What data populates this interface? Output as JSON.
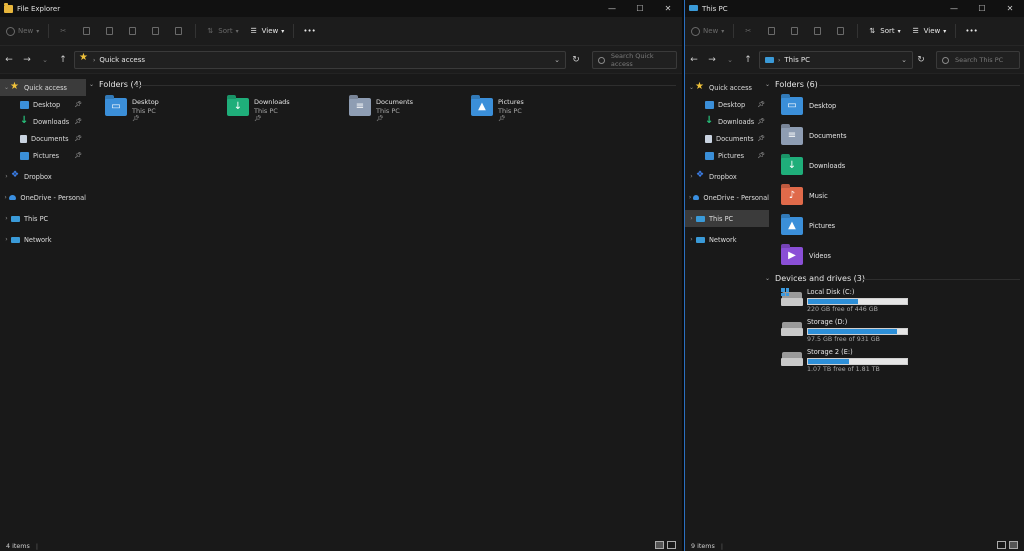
{
  "win1": {
    "title": "File Explorer",
    "toolbar": {
      "new": "New",
      "sort": "Sort",
      "view": "View",
      "more": "•••"
    },
    "address": {
      "location": "Quick access"
    },
    "search_placeholder": "Search Quick access",
    "nav": {
      "quick_access": "Quick access",
      "desktop": "Desktop",
      "downloads": "Downloads",
      "documents": "Documents",
      "pictures": "Pictures",
      "dropbox": "Dropbox",
      "onedrive": "OneDrive - Personal",
      "this_pc": "This PC",
      "network": "Network"
    },
    "section": "Folders (4)",
    "folders": [
      {
        "name": "Desktop",
        "location": "This PC"
      },
      {
        "name": "Downloads",
        "location": "This PC"
      },
      {
        "name": "Documents",
        "location": "This PC"
      },
      {
        "name": "Pictures",
        "location": "This PC"
      }
    ],
    "status": "4 items"
  },
  "win2": {
    "title": "This PC",
    "toolbar": {
      "new": "New",
      "sort": "Sort",
      "view": "View",
      "more": "•••"
    },
    "address": {
      "location": "This PC"
    },
    "search_placeholder": "Search This PC",
    "nav": {
      "quick_access": "Quick access",
      "desktop": "Desktop",
      "downloads": "Downloads",
      "documents": "Documents",
      "pictures": "Pictures",
      "dropbox": "Dropbox",
      "onedrive": "OneDrive - Personal",
      "this_pc": "This PC",
      "network": "Network"
    },
    "folders_section": "Folders (6)",
    "folders": [
      "Desktop",
      "Documents",
      "Downloads",
      "Music",
      "Pictures",
      "Videos"
    ],
    "drives_section": "Devices and drives (3)",
    "drives": [
      {
        "name": "Local Disk (C:)",
        "free": "220 GB free of 446 GB",
        "used_fraction": 0.51
      },
      {
        "name": "Storage (D:)",
        "free": "97.5 GB free of 931 GB",
        "used_fraction": 0.9
      },
      {
        "name": "Storage 2 (E:)",
        "free": "1.07 TB free of 1.81 TB",
        "used_fraction": 0.41
      }
    ],
    "status": "9 items"
  },
  "colors": {
    "folder_blue": "#3b8fd9",
    "downloads_green": "#1fae7a",
    "documents_gray": "#8e9db3",
    "music_orange": "#e06a4a",
    "videos_purple": "#8a4fd6",
    "drive_bar": "#2d8fd8",
    "star": "#f0c23a"
  }
}
